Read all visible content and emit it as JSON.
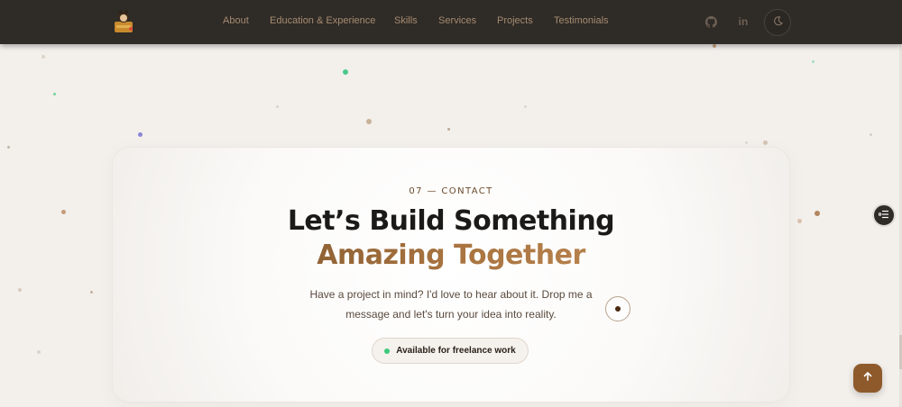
{
  "nav": {
    "items": [
      {
        "label": "About"
      },
      {
        "label": "Education & Experience"
      },
      {
        "label": "Skills"
      },
      {
        "label": "Services"
      },
      {
        "label": "Projects"
      },
      {
        "label": "Testimonials"
      }
    ],
    "icons": [
      "github-icon",
      "linkedin-icon",
      "moon-icon"
    ]
  },
  "contact": {
    "eyebrow": "07 — CONTACT",
    "title_line1": "Let’s Build Something",
    "title_line2": "Amazing Together",
    "description": "Have a project in mind? I'd love to hear about it. Drop me a message and let's turn your idea into reality.",
    "badge": "Available for freelance work"
  },
  "colors": {
    "header_bg": "#2f2b27",
    "accent": "#a8733f",
    "available_status": "#3cc97a",
    "back_to_top_bg": "#8f5a2b"
  }
}
